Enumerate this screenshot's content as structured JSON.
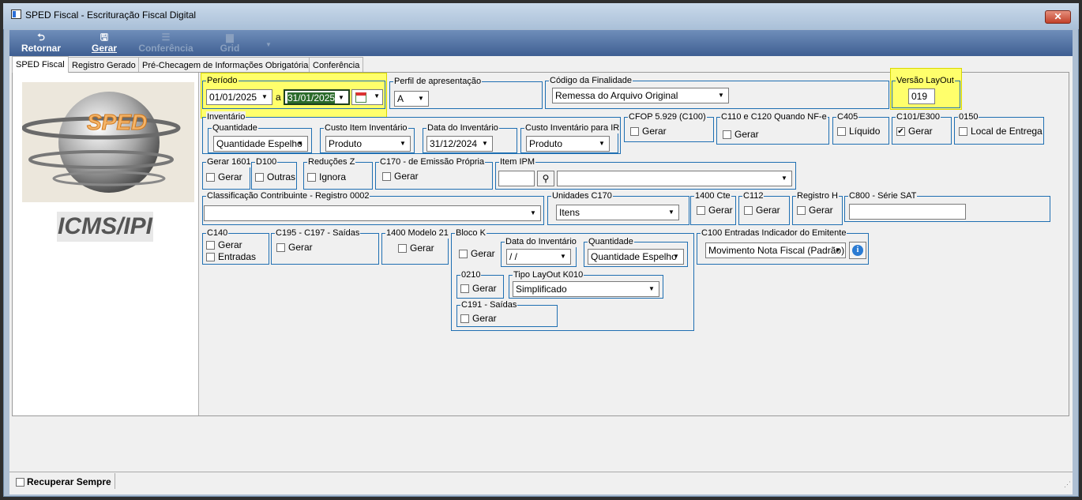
{
  "window": {
    "title": "SPED Fiscal - Escrituração Fiscal Digital",
    "close": "✕"
  },
  "toolbar": {
    "retornar": "Retornar",
    "gerar": "Gerar",
    "conferencia": "Conferência",
    "grid": "Grid"
  },
  "tabs": [
    "SPED Fiscal",
    "Registro Gerado",
    "Pré-Checagem de Informações Obrigatórias",
    "Conferência"
  ],
  "logo": {
    "sped": "SPED",
    "icms": "ICMS/IPI"
  },
  "periodo": {
    "label": "Período",
    "start": "01/01/2025",
    "sep": "a",
    "end": "31/01/2025"
  },
  "perfil": {
    "label": "Perfil de apresentação",
    "value": "A"
  },
  "finalidade": {
    "label": "Código da Finalidade",
    "value": "Remessa do Arquivo Original"
  },
  "versao": {
    "label": "Versão LayOut",
    "value": "019"
  },
  "inventario": {
    "label": "Inventário",
    "quantidade_label": "Quantidade",
    "quantidade": "Quantidade Espelho",
    "custo_label": "Custo Item Inventário",
    "custo": "Produto",
    "data_label": "Data do Inventário",
    "data": "31/12/2024",
    "custo_ir_label": "Custo Inventário para IR",
    "custo_ir": "Produto"
  },
  "cfop": {
    "label": "CFOP 5.929 (C100)",
    "check": "Gerar"
  },
  "c110": {
    "label": "C110 e C120 Quando NF-e",
    "check": "Gerar"
  },
  "c405": {
    "label": "C405",
    "check": "Líquido"
  },
  "c101": {
    "label": "C101/E300",
    "check": "Gerar"
  },
  "r0150": {
    "label": "0150",
    "check": "Local de Entrega"
  },
  "gerar1601": {
    "label": "Gerar 1601",
    "check": "Gerar"
  },
  "d100": {
    "label": "D100",
    "check": "Outras"
  },
  "reducoes": {
    "label": "Reduções Z",
    "check": "Ignora"
  },
  "c170": {
    "label": "C170 - de Emissão Própria",
    "check": "Gerar"
  },
  "item_ipm": {
    "label": "Item IPM"
  },
  "classificacao": {
    "label": "Classificação Contribuinte - Registro 0002"
  },
  "unidades": {
    "label": "Unidades C170",
    "value": "Itens"
  },
  "cte1400": {
    "label": "1400 Cte",
    "check": "Gerar"
  },
  "c112": {
    "label": "C112",
    "check": "Gerar"
  },
  "registroh": {
    "label": "Registro H",
    "check": "Gerar"
  },
  "c800": {
    "label": "C800 - Série SAT"
  },
  "c140": {
    "label": "C140",
    "check1": "Gerar",
    "check2": "Entradas"
  },
  "c195": {
    "label": "C195 - C197 - Saídas",
    "check": "Gerar"
  },
  "m1400": {
    "label": "1400 Modelo 21",
    "check": "Gerar"
  },
  "blocok": {
    "label": "Bloco K",
    "check": "Gerar",
    "data_label": "Data do Inventário",
    "data": " /  /",
    "quantidade_label": "Quantidade",
    "quantidade": "Quantidade Espelho",
    "r0210_label": "0210",
    "r0210_check": "Gerar",
    "tipo_label": "Tipo LayOut K010",
    "tipo": "Simplificado",
    "c191_label": "C191 - Saídas",
    "c191_check": "Gerar"
  },
  "c100": {
    "label": "C100 Entradas Indicador do Emitente",
    "value": "Movimento Nota Fiscal (Padrão)"
  },
  "status": {
    "recuperar": "Recuperar Sempre"
  }
}
